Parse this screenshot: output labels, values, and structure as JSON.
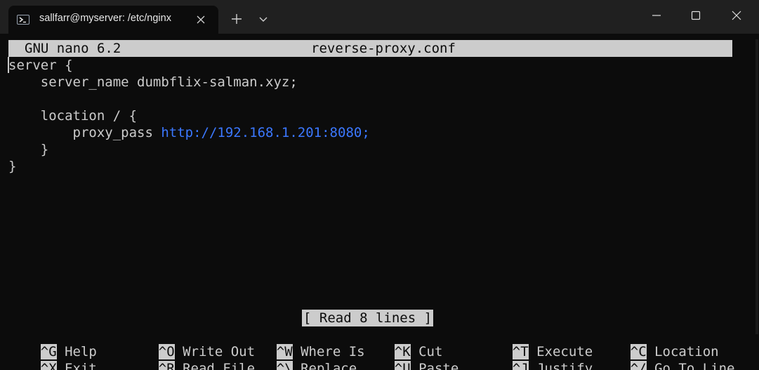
{
  "window": {
    "tab_title": "sallfarr@myserver: /etc/nginx",
    "tab_icon": "powershell-icon"
  },
  "nano": {
    "version": "GNU nano 6.2",
    "filename": "reverse-proxy.conf",
    "status": "[ Read 8 lines ]"
  },
  "file_lines": {
    "l1": "server {",
    "l2": "    server_name dumbflix-salman.xyz;",
    "l3": "",
    "l4": "    location / {",
    "l5_prefix": "        proxy_pass ",
    "l5_url": "http://192.168.1.201:8080;",
    "l6": "    }",
    "l7": "}"
  },
  "shortcuts": {
    "help": {
      "key": "^G",
      "label": "Help"
    },
    "exit": {
      "key": "^X",
      "label": "Exit"
    },
    "write_out": {
      "key": "^O",
      "label": "Write Out"
    },
    "read_file": {
      "key": "^R",
      "label": "Read File"
    },
    "where_is": {
      "key": "^W",
      "label": "Where Is"
    },
    "replace": {
      "key": "^\\",
      "label": "Replace"
    },
    "cut": {
      "key": "^K",
      "label": "Cut"
    },
    "paste": {
      "key": "^U",
      "label": "Paste"
    },
    "execute": {
      "key": "^T",
      "label": "Execute"
    },
    "justify": {
      "key": "^J",
      "label": "Justify"
    },
    "location": {
      "key": "^C",
      "label": "Location"
    },
    "go_to_line": {
      "key": "^/",
      "label": "Go To Line"
    }
  },
  "colors": {
    "terminal_bg": "#0c0c0c",
    "terminal_fg": "#cccccc",
    "titlebar_bg": "#202020",
    "url_blue": "#3b78ff"
  }
}
